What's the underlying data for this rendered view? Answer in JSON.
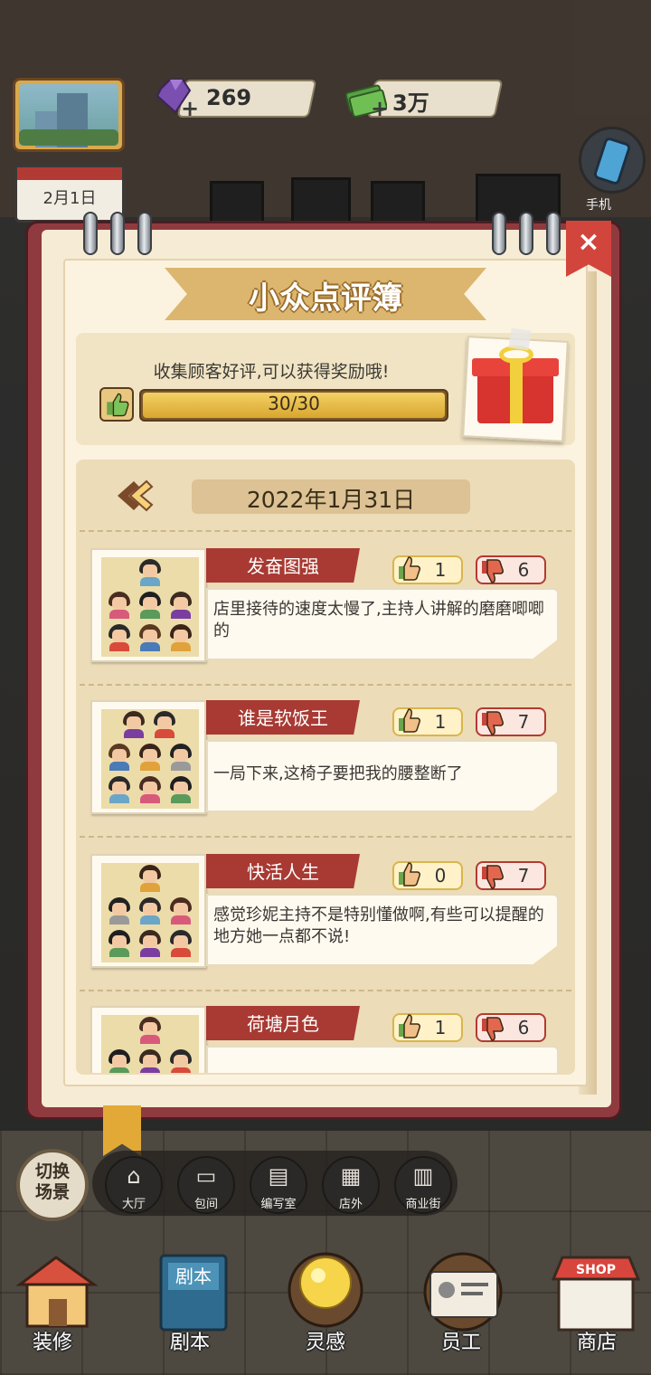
{
  "hud": {
    "gems": "269",
    "cash": "3万",
    "plus": "+",
    "date": "2月1日",
    "phone_label": "手机"
  },
  "modal": {
    "title": "小众点评簿",
    "close": "×",
    "reward": {
      "hint": "收集顾客好评,可以获得奖励哦!",
      "progress_text": "30/30",
      "progress": 1.0
    },
    "list": {
      "date": "2022年1月31日",
      "reviews": [
        {
          "name": "发奋图强",
          "likes": "1",
          "dislikes": "6",
          "text": "店里接待的速度太慢了,主持人讲解的磨磨唧唧的"
        },
        {
          "name": "谁是软饭王",
          "likes": "1",
          "dislikes": "7",
          "text": "一局下来,这椅子要把我的腰整断了"
        },
        {
          "name": "快活人生",
          "likes": "0",
          "dislikes": "7",
          "text": "感觉珍妮主持不是特别懂做啊,有些可以提醒的地方她一点都不说!"
        },
        {
          "name": "荷塘月色",
          "likes": "1",
          "dislikes": "6",
          "text": ""
        }
      ]
    }
  },
  "bottom": {
    "switch_scene": "切换\n场景",
    "tabs": [
      {
        "label": "大厅",
        "icon": "house-icon"
      },
      {
        "label": "包间",
        "icon": "sofa-icon"
      },
      {
        "label": "编写室",
        "icon": "desk-icon"
      },
      {
        "label": "店外",
        "icon": "storefront-icon"
      },
      {
        "label": "商业街",
        "icon": "street-icon"
      }
    ],
    "main": [
      {
        "label": "装修",
        "icon": "renovate-house-icon"
      },
      {
        "label": "剧本",
        "icon": "script-book-icon"
      },
      {
        "label": "灵感",
        "icon": "lightbulb-icon"
      },
      {
        "label": "员工",
        "icon": "staff-card-icon"
      },
      {
        "label": "商店",
        "icon": "shop-icon"
      }
    ],
    "book_title": "剧本",
    "shop_sign": "SHOP"
  },
  "colors": {
    "notebook_cover": "#8f3a3f",
    "name_banner": "#a83a33",
    "progress_fill": "#e3b43f",
    "title_banner": "#dcb66e"
  }
}
